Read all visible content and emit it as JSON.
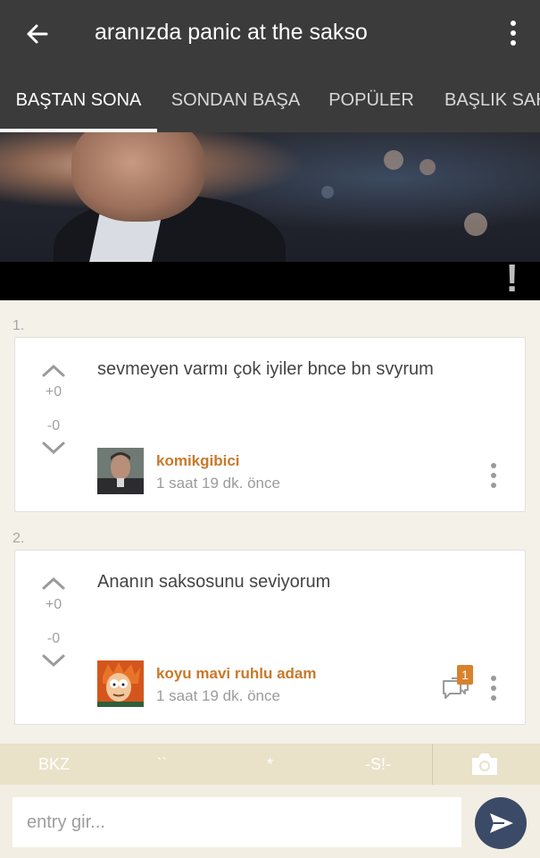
{
  "appbar": {
    "title": "aranızda panic at the sakso",
    "back_icon": "arrow-left-icon",
    "menu_icon": "more-vertical-icon"
  },
  "tabs": [
    {
      "label": "BAŞTAN SONA",
      "active": true
    },
    {
      "label": "SONDAN BAŞA",
      "active": false
    },
    {
      "label": "POPÜLER",
      "active": false
    },
    {
      "label": "BAŞLIK SAH",
      "active": false
    }
  ],
  "hero": {
    "alert": "!"
  },
  "entries": [
    {
      "number": "1.",
      "text": "sevmeyen varmı çok iyiler bnce bn svyrum",
      "up_score": "+0",
      "down_score": "-0",
      "author": "komikgibici",
      "time": "1 saat 19 dk. önce"
    },
    {
      "number": "2.",
      "text": "Ananın saksosunu seviyorum",
      "up_score": "+0",
      "down_score": "-0",
      "author": "koyu mavi ruhlu adam",
      "time": "1 saat 19 dk. önce",
      "comment_count": "1"
    }
  ],
  "toolbar": {
    "bkz": "BKZ",
    "backtick": "``",
    "star": "*",
    "spoiler": "-S!-",
    "camera_icon": "camera-icon"
  },
  "composer": {
    "placeholder": "entry gir...",
    "value": "",
    "send_icon": "send-icon"
  },
  "colors": {
    "bar": "#3b3b3b",
    "author": "#c8792b",
    "badge": "#d9822b",
    "toolbar": "#e9e2c9",
    "send": "#3b4a66"
  }
}
